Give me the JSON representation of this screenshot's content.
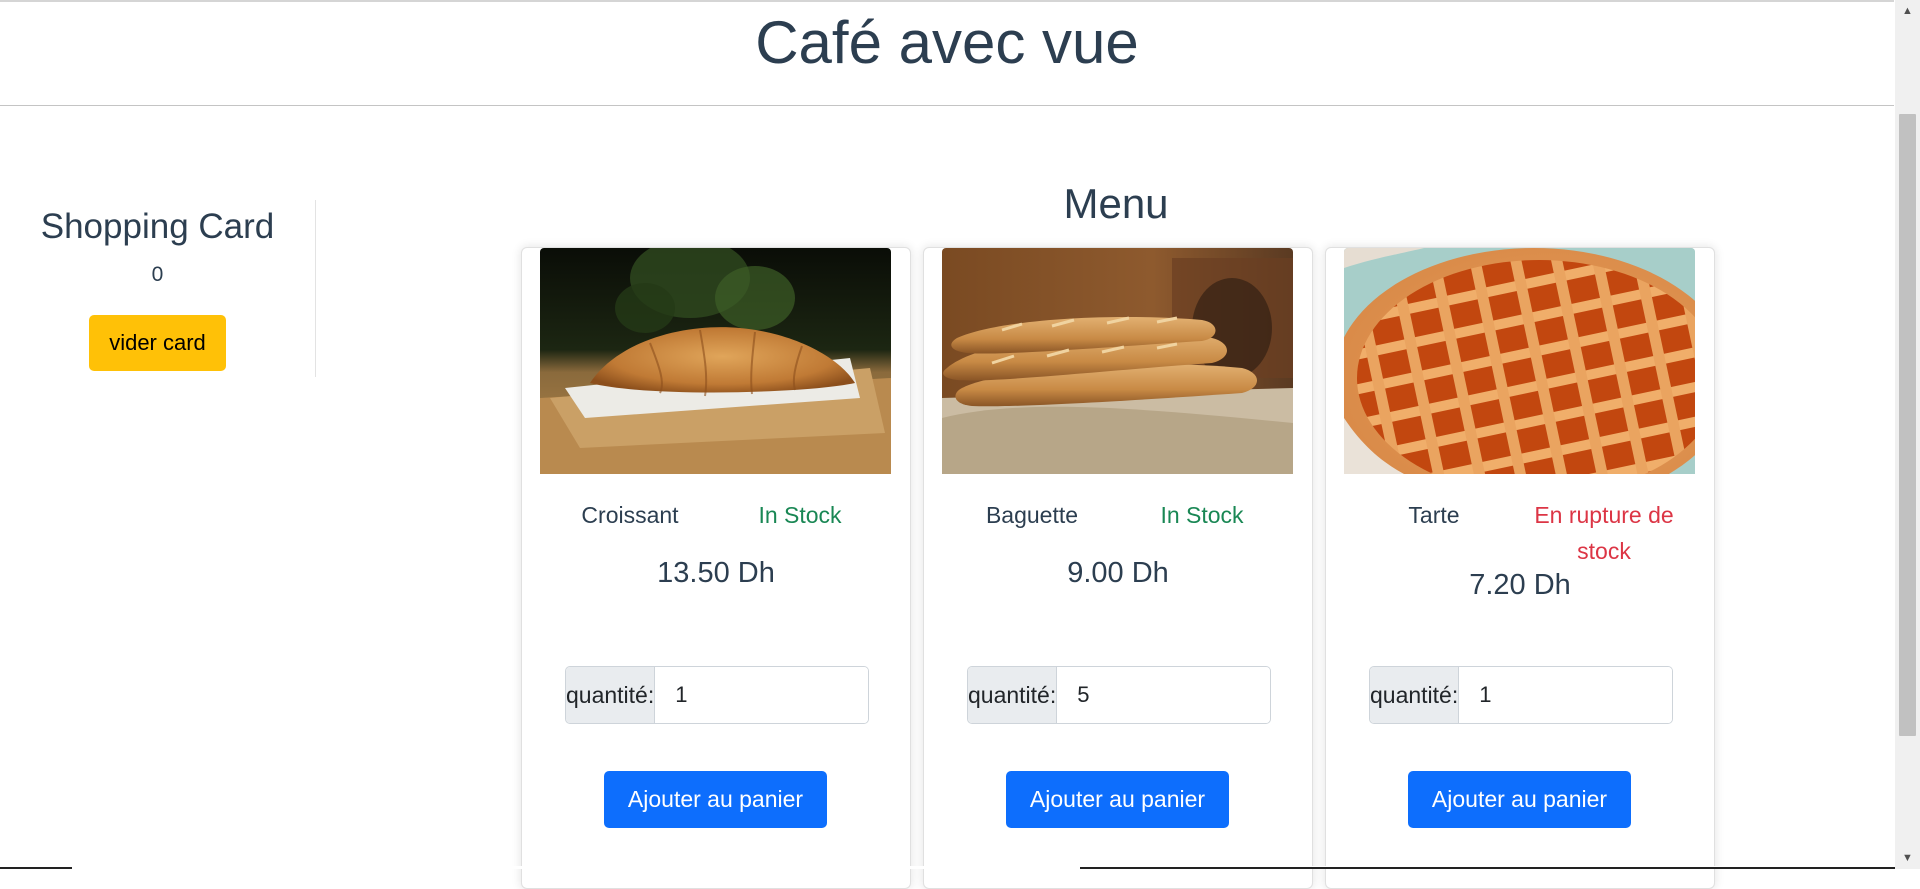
{
  "header": {
    "title": "Café avec vue"
  },
  "sidebar": {
    "title": "Shopping Card",
    "count": "0",
    "clear_button": "vider card"
  },
  "menu": {
    "title": "Menu",
    "products": [
      {
        "name": "Croissant",
        "stock": "In Stock",
        "price": "13.50 Dh",
        "quantity_label": "quantité:",
        "quantity": "1",
        "button": "Ajouter au panier",
        "image": "croissant-photo"
      },
      {
        "name": "Baguette",
        "stock": "In Stock",
        "price": "9.00 Dh",
        "quantity_label": "quantité:",
        "quantity": "5",
        "button": "Ajouter au panier",
        "image": "baguette-photo"
      },
      {
        "name": "Tarte",
        "stock": "En rupture de stock",
        "price": "7.20 Dh",
        "quantity_label": "quantité:",
        "quantity": "1",
        "button": "Ajouter au panier",
        "image": "tarte-photo"
      }
    ]
  },
  "colors": {
    "in_stock": "#198754",
    "out_of_stock": "#dc3545",
    "primary": "#0d6efd",
    "warning": "#ffc107",
    "text": "#2c3e50"
  },
  "scrollbar": {
    "up_icon": "chevron-up-icon",
    "down_icon": "chevron-down-icon"
  }
}
